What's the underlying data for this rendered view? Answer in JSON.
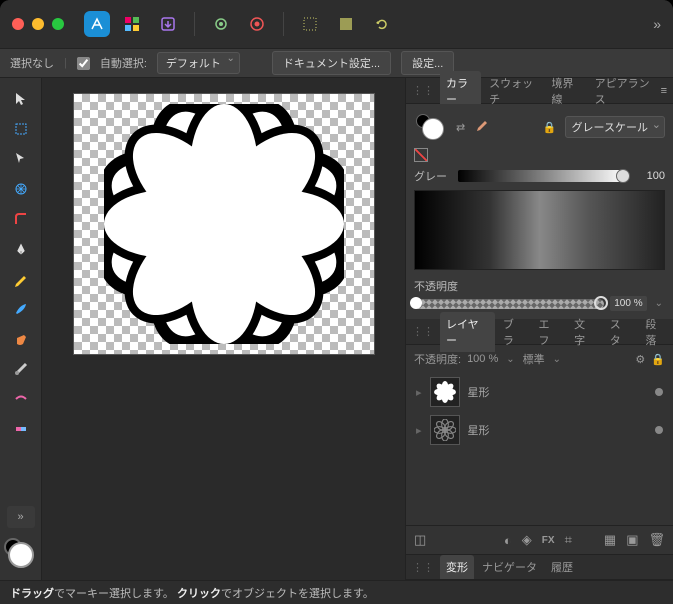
{
  "titlebar": {
    "overflow": "»"
  },
  "contextbar": {
    "no_selection": "選択なし",
    "auto_select": "自動選択:",
    "preset": "デフォルト",
    "doc_settings": "ドキュメント設定...",
    "settings": "設定..."
  },
  "panels": {
    "color": {
      "tabs": [
        "カラー",
        "スウォッチ",
        "境界線",
        "アピアランス"
      ],
      "active_tab": 0,
      "mode": "グレースケール",
      "grey_label": "グレー",
      "grey_value": "100",
      "opacity_label": "不透明度",
      "opacity_value": "100 %"
    },
    "layers": {
      "tabs": [
        "レイヤー",
        "ブラ",
        "エフ",
        "文字",
        "スタ",
        "段落"
      ],
      "active_tab": 0,
      "opacity_label": "不透明度:",
      "opacity_value": "100 %",
      "blend_mode": "標準",
      "items": [
        {
          "name": "星形"
        },
        {
          "name": "星形"
        }
      ]
    },
    "bottom": {
      "tabs": [
        "変形",
        "ナビゲータ",
        "履歴"
      ],
      "active_tab": 0
    }
  },
  "status": {
    "part1_bold": "ドラッグ",
    "part1_rest": "でマーキー選択します。",
    "part2_bold": "クリック",
    "part2_rest": "でオブジェクトを選択します。"
  }
}
